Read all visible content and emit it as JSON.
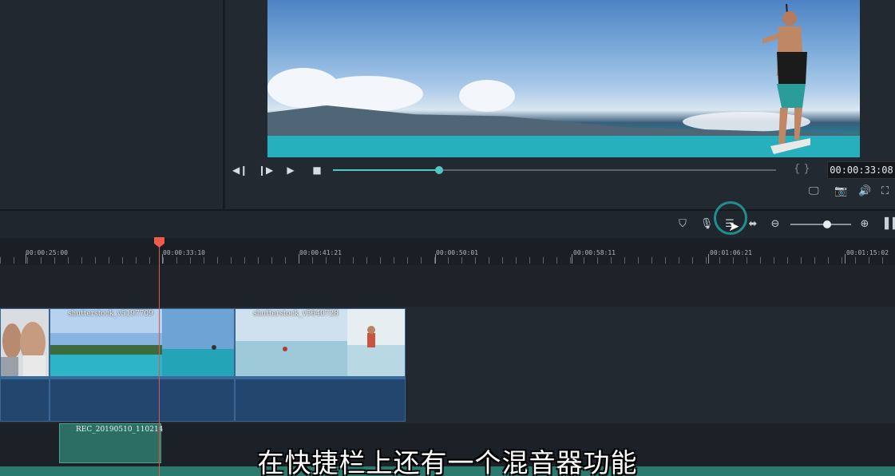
{
  "player": {
    "timecode": "00:00:33:08",
    "brackets": "{ }",
    "progress": 0.24,
    "buttons": {
      "prev_frame": "◀❙",
      "next_frame": "❙▶",
      "play": "▶",
      "stop": "■"
    },
    "tools": {
      "display": "🖵",
      "snapshot": "📷",
      "volume": "🔊",
      "fullscreen": "⛶"
    }
  },
  "toolbar": {
    "icons": {
      "marker": "⛉",
      "mic": "🎙",
      "mixer": "☰",
      "fit": "⬌",
      "zoom_out": "⊖",
      "zoom_in": "⊕",
      "more": "▐▐"
    },
    "zoom_level": 0.6
  },
  "ruler": {
    "labels": [
      "00:00:25:00",
      "00:00:33:10",
      "00:00:41:21",
      "00:00:50:01",
      "00:00:58:11",
      "00:01:06:21",
      "00:01:15:02"
    ]
  },
  "clips": {
    "clip2_title": "shutterstock_v5197709",
    "clip3_title": "shutterstock_v5640728"
  },
  "audio": {
    "clip_title": "REC_20190510_110214"
  },
  "subtitle": "在快捷栏上还有一个混音器功能",
  "colors": {
    "accent": "#4fc8c4",
    "playhead": "#f05b4c",
    "video_clip": "#23466e",
    "audio_clip": "#2c6e63"
  }
}
